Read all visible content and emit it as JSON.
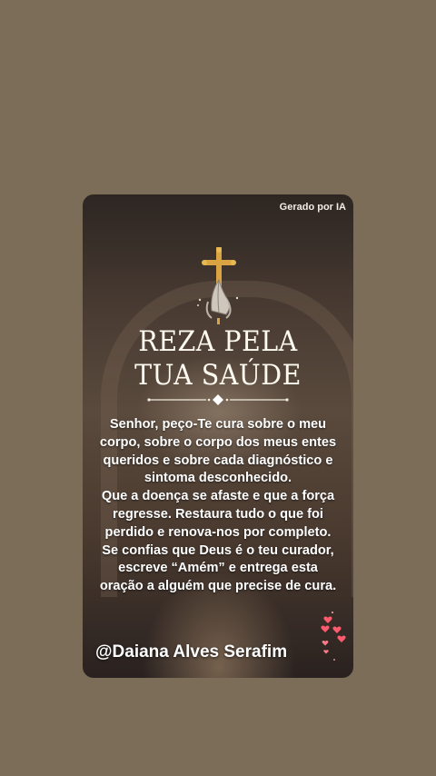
{
  "badge": {
    "text": "Gerado por IA"
  },
  "title": {
    "line1": "REZA PELA",
    "line2": "TUA SAÚDE"
  },
  "prayer": {
    "paragraph1": "Senhor, peço-Te cura sobre o meu corpo, sobre o corpo dos meus entes queridos e sobre cada diagnóstico e sintoma desconhecido.",
    "paragraph2": "Que a doença se afaste e que a força regresse. Restaura tudo o que foi perdido e renova-nos por completo. Se confias que Deus é o teu curador, escreve “Amém” e entrega esta oração a alguém que precise de cura."
  },
  "author": {
    "handle": "@Daiana Alves Serafim"
  },
  "icons": {
    "emblem": "cross-praying-hands-icon",
    "hearts": "floating-hearts-icon",
    "divider": "diamond-divider-icon"
  },
  "colors": {
    "page_background": "#7b6d58",
    "gold": "#d9a441",
    "heart": "#ff5a6e",
    "text": "#ffffff"
  }
}
